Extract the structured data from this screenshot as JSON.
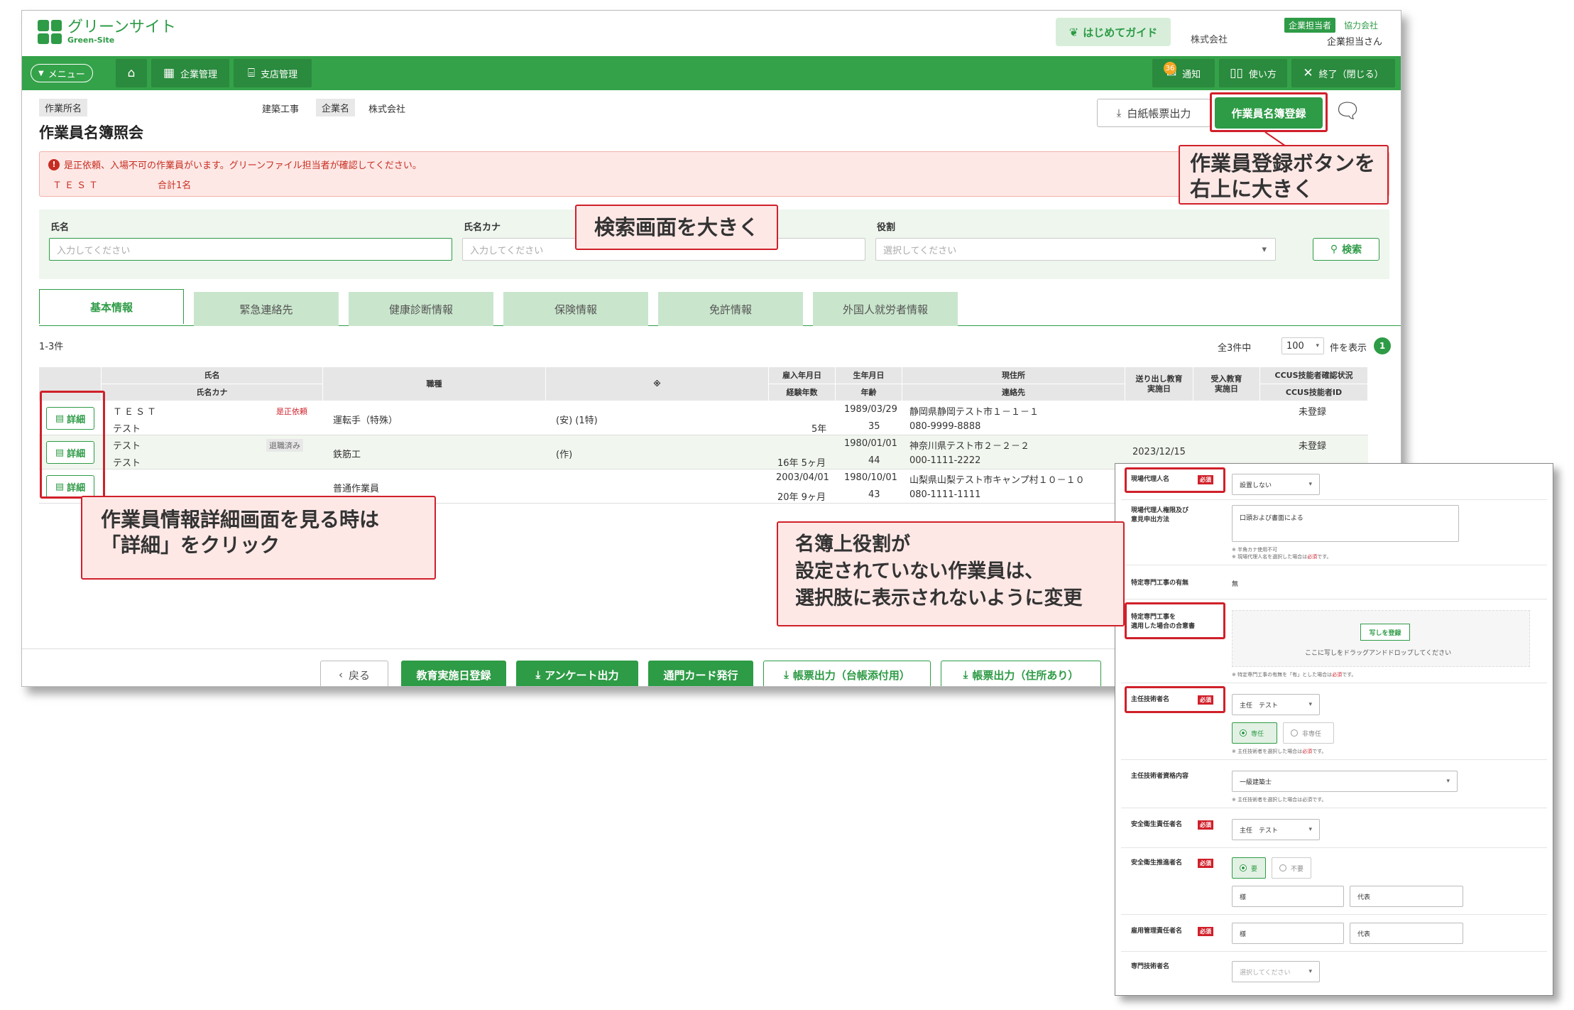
{
  "header": {
    "logo_name": "グリーンサイト",
    "logo_sub": "Green-Site",
    "guide_label": "はじめてガイド",
    "company": "株式会社",
    "role_badge": "企業担当者",
    "coop_company": "協力会社",
    "user_name": "企業担当さん"
  },
  "nav": {
    "menu_label": "メニュー",
    "company_mgmt": "企業管理",
    "branch_mgmt": "支店管理",
    "notification_count": "36",
    "notification_label": "通知",
    "usage_label": "使い方",
    "exit_label": "終了（閉じる）"
  },
  "page": {
    "site_tag": "作業所名",
    "site_value": "建築工事",
    "company_tag": "企業名",
    "company_value": "株式会社",
    "title": "作業員名簿照会",
    "paper_output": "白紙帳票出力",
    "register_button": "作業員名簿登録"
  },
  "alert": {
    "message": "是正依頼、入場不可の作業員がいます。グリーンファイル担当者が確認してください。",
    "name": "ＴＥＳＴ",
    "total": "合計1名"
  },
  "search": {
    "name_label": "氏名",
    "name_placeholder": "入力してください",
    "kana_label": "氏名カナ",
    "kana_placeholder": "入力してください",
    "role_label": "役割",
    "role_placeholder": "選択してください",
    "search_button": "検索"
  },
  "tabs": [
    "基本情報",
    "緊急連絡先",
    "健康診断情報",
    "保険情報",
    "免許情報",
    "外国人就労者情報"
  ],
  "results": {
    "count": "1-3件",
    "total_prefix": "全3件中",
    "per_page": "100",
    "display_suffix": "件を表示",
    "current_page": "1"
  },
  "table": {
    "headers": {
      "name": "氏名",
      "kana": "氏名カナ",
      "job": "職種",
      "extra": "※",
      "hire_date": "雇入年月日",
      "years": "経験年数",
      "birth": "生年月日",
      "age": "年齢",
      "address": "現住所",
      "contact": "連絡先",
      "send_edu": "送り出し教育\n実施日",
      "recv_edu": "受入教育\n実施日",
      "ccus_status": "CCUS技能者確認状況",
      "ccus_id": "CCUS技能者ID"
    },
    "detail_label": "詳細",
    "rows": [
      {
        "name": "ＴＥＳＴ",
        "status": "是正依頼",
        "kana": "テスト",
        "job": "運転手（特殊）",
        "qual": "(安) (1特)",
        "hire_date": "",
        "years": "5年",
        "birth": "1989/03/29",
        "age": "35",
        "address": "静岡県静岡テスト市１－１－１",
        "contact": "080-9999-8888",
        "send_edu": "",
        "recv_edu": "",
        "ccus": "未登録"
      },
      {
        "name": "テスト",
        "status": "退職済み",
        "kana": "テスト",
        "job": "鉄筋工",
        "qual": "(作)",
        "hire_date": "",
        "years": "16年 5ヶ月",
        "birth": "1980/01/01",
        "age": "44",
        "address": "神奈川県テスト市２－２－２",
        "contact": "000-1111-2222",
        "send_edu": "2023/12/15",
        "recv_edu": "",
        "ccus": "未登録"
      },
      {
        "name": "",
        "status": "",
        "kana": "",
        "job": "普通作業員",
        "qual": "",
        "hire_date": "2003/04/01",
        "years": "20年 9ヶ月",
        "birth": "1980/10/01",
        "age": "43",
        "address": "山梨県山梨テスト市キャンプ村１０－１０",
        "contact": "080-1111-1111",
        "send_edu": "",
        "recv_edu": "",
        "ccus": ""
      }
    ]
  },
  "footer": {
    "back": "戻る",
    "edu_register": "教育実施日登録",
    "survey_output": "アンケート出力",
    "gate_card": "通門カード発行",
    "report_ledger": "帳票出力（台帳添付用）",
    "report_address": "帳票出力（住所あり）"
  },
  "callouts": {
    "register_note": "作業員登録ボタンを\n右上に大きく",
    "search_note": "検索画面を大きく",
    "detail_note": "作業員情報詳細画面を見る時は\n「詳細」をクリック",
    "role_note": "名簿上役割が\n設定されていない作業員は、\n選択肢に表示されないように変更"
  },
  "detail_panel": {
    "required": "必須",
    "site_agent_label": "現場代理人名",
    "site_agent_value": "設置しない",
    "authority_label": "現場代理人権限及び\n意見申出方法",
    "authority_value": "口頭および書面による",
    "authority_note1": "※ 半角カナ使用不可",
    "authority_note2_pre": "※ 現場代理人名を選択した場合は",
    "authority_note2_req": "必須",
    "authority_note2_post": "です。",
    "special_label": "特定専門工事の有無",
    "special_value": "無",
    "consent_label": "特定専門工事を\n適用した場合の合意書",
    "photo_button": "写しを登録",
    "drop_text": "ここに写しをドラッグアンドドロップしてください",
    "consent_note_pre": "※ 特定専門工事の有無を「有」とした場合は",
    "consent_note_req": "必須",
    "consent_note_post": "です。",
    "chief_label": "主任技術者名",
    "chief_value": "主任　テスト",
    "dedicated": "専任",
    "non_dedicated": "非専任",
    "chief_note_pre": "※ 主任技術者を選択した場合は",
    "chief_note_req": "必須",
    "chief_note_post": "です。",
    "qual_label": "主任技術者資格内容",
    "qual_value": "一級建築士",
    "qual_note": "※ 主任技術者を選択した場合は必須です。",
    "safety_mgr_label": "安全衛生責任者名",
    "safety_mgr_value": "主任　テスト",
    "safety_promoter_label": "安全衛生推進者名",
    "needed": "要",
    "not_needed": "不要",
    "sama": "様",
    "daihyo": "代表",
    "employment_label": "雇用管理責任者名",
    "specialist_label": "専門技術者名",
    "specialist_placeholder": "選択してください"
  }
}
